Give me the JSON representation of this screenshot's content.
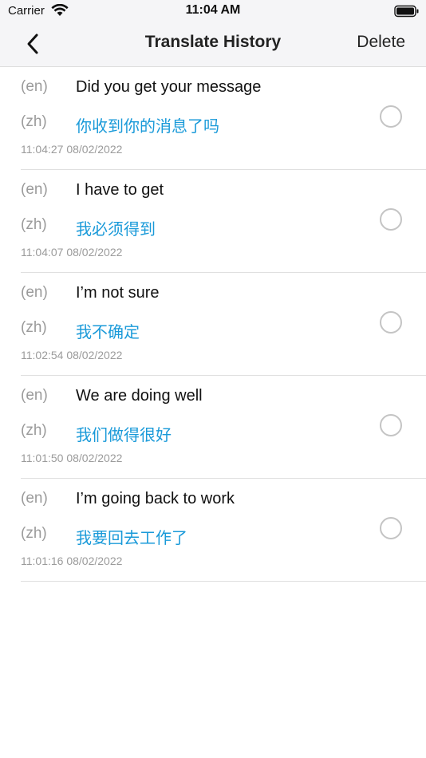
{
  "status_bar": {
    "carrier": "Carrier",
    "time": "11:04 AM"
  },
  "nav": {
    "title": "Translate History",
    "delete_label": "Delete"
  },
  "colors": {
    "accent": "#1a9ad9",
    "muted": "#9b9b9b"
  },
  "history": [
    {
      "src_lang": "(en)",
      "src_text": "Did you get your message",
      "dst_lang": "(zh)",
      "dst_text": "你收到你的消息了吗",
      "timestamp": "11:04:27 08/02/2022"
    },
    {
      "src_lang": "(en)",
      "src_text": "I have to get",
      "dst_lang": "(zh)",
      "dst_text": "我必须得到",
      "timestamp": "11:04:07 08/02/2022"
    },
    {
      "src_lang": "(en)",
      "src_text": "I’m not sure",
      "dst_lang": "(zh)",
      "dst_text": "我不确定",
      "timestamp": "11:02:54 08/02/2022"
    },
    {
      "src_lang": "(en)",
      "src_text": "We are doing well",
      "dst_lang": "(zh)",
      "dst_text": "我们做得很好",
      "timestamp": "11:01:50 08/02/2022"
    },
    {
      "src_lang": "(en)",
      "src_text": "I’m going back to work",
      "dst_lang": "(zh)",
      "dst_text": "我要回去工作了",
      "timestamp": "11:01:16 08/02/2022"
    }
  ]
}
